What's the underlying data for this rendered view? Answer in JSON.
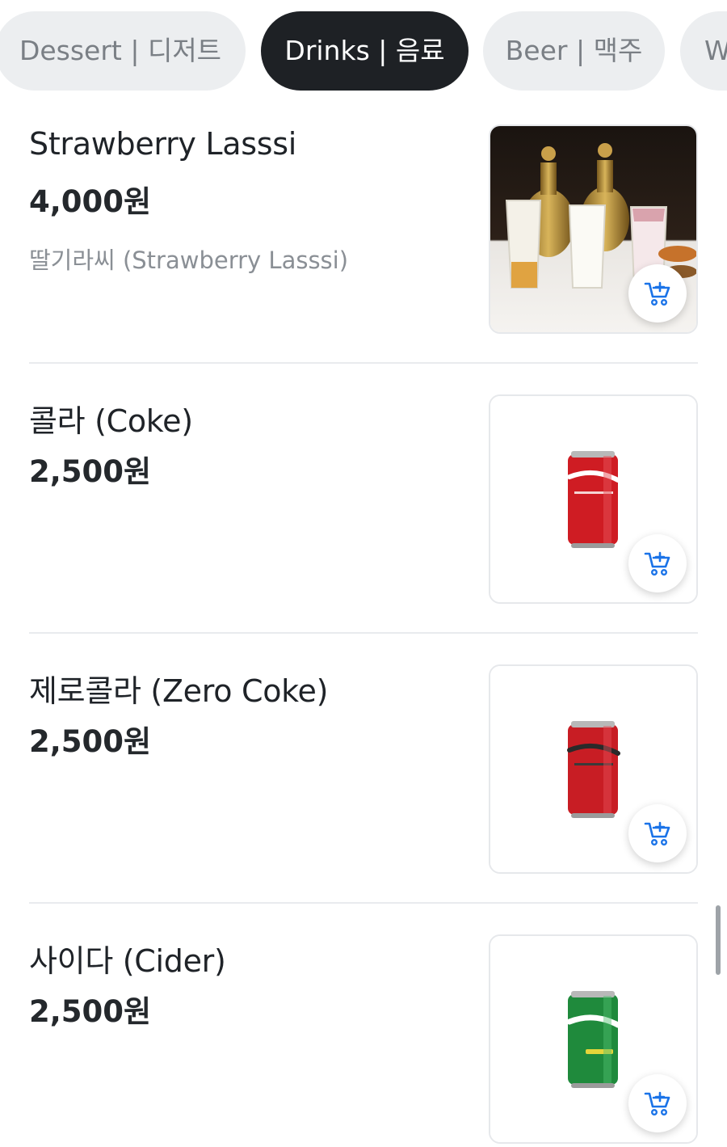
{
  "tabs": [
    {
      "label": "Dessert | 디저트",
      "active": false
    },
    {
      "label": "Drinks | 음료",
      "active": true
    },
    {
      "label": "Beer | 맥주",
      "active": false
    },
    {
      "label": "W",
      "active": false
    }
  ],
  "items": [
    {
      "name": "Strawberry Lasssi",
      "price": "4,000원",
      "description": "딸기라씨 (Strawberry Lasssi)",
      "image": "lassi-glasses-photo"
    },
    {
      "name": "콜라 (Coke)",
      "price": "2,500원",
      "description": "",
      "image": "coca-cola-can-photo"
    },
    {
      "name": "제로콜라 (Zero Coke)",
      "price": "2,500원",
      "description": "",
      "image": "coca-cola-zero-can-photo"
    },
    {
      "name": "사이다 (Cider)",
      "price": "2,500원",
      "description": "",
      "image": "sprite-can-photo"
    }
  ],
  "icons": {
    "cart": "add-to-cart-icon"
  },
  "colors": {
    "accent": "#1a73e8",
    "active_tab_bg": "#1e2125",
    "tab_bg": "#eceef0"
  }
}
